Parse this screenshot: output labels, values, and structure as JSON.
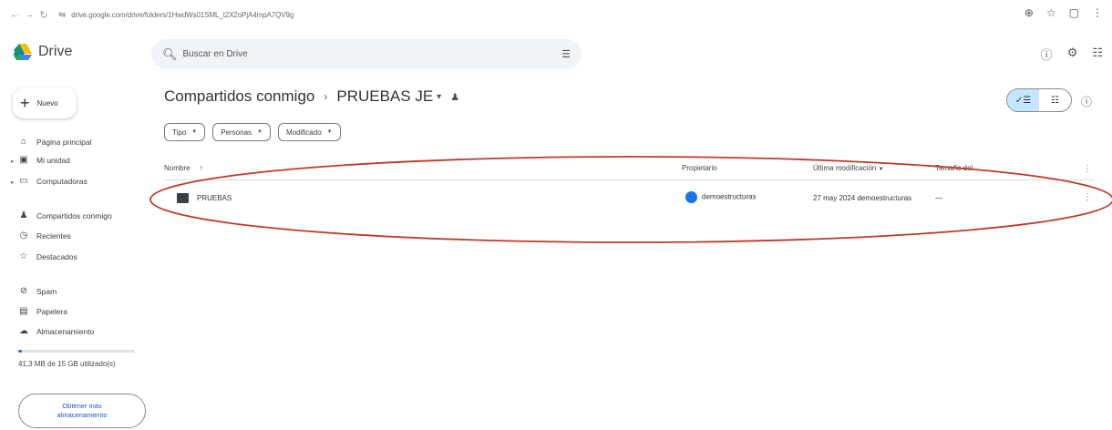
{
  "browser": {
    "back": "←",
    "forward": "→",
    "reload": "↻",
    "site_info": "⇋",
    "url": "drive.google.com/drive/folders/1HwdWs01SML_t2X2oPjA4mpA7QV9g",
    "actions": [
      "⊕",
      "☆",
      "▢",
      "⋮"
    ]
  },
  "header": {
    "app_name": "Drive",
    "search_icon": "search-icon",
    "search_placeholder": "Buscar en Drive",
    "filter_icon": "tune-icon",
    "right_icons": [
      "help-icon",
      "settings-icon",
      "apps-icon"
    ]
  },
  "sidebar": {
    "new_label": "Nuevo",
    "items": [
      {
        "label": "Página principal",
        "icon": "home-icon"
      },
      {
        "label": "Mi unidad",
        "icon": "my-drive-icon"
      },
      {
        "label": "Computadoras",
        "icon": "computer-icon"
      },
      {
        "label": "Compartidos conmigo",
        "icon": "people-icon"
      },
      {
        "label": "Recientes",
        "icon": "clock-icon"
      },
      {
        "label": "Destacados",
        "icon": "star-icon"
      },
      {
        "label": "Spam",
        "icon": "spam-icon"
      },
      {
        "label": "Papelera",
        "icon": "trash-icon"
      },
      {
        "label": "Almacenamiento",
        "icon": "cloud-icon"
      }
    ],
    "storage_used_fraction": 0.03,
    "storage_text": "41,3 MB de 15 GB utilizado(s)",
    "get_more_label": "Obtener más almacenamiento"
  },
  "main": {
    "breadcrumb_root": "Compartidos conmigo",
    "breadcrumb_current": "PRUEBAS JE",
    "filters": [
      "Tipo",
      "Personas",
      "Modificado"
    ],
    "columns": {
      "name": "Nombre",
      "sort_arrow": "↑",
      "owner": "Propietario",
      "modified": "Última modificación",
      "size": "Tamaño del"
    },
    "rows": [
      {
        "name": "PRUEBAS",
        "owner": "demoestructuras",
        "modified": "27 may 2024 demoestructuras",
        "size": "—"
      }
    ]
  },
  "colors": {
    "accent": "#1a73e8",
    "annotation": "#c0392b",
    "search_bg": "#f0f3f8",
    "toggle_on": "#c2e7ff"
  }
}
